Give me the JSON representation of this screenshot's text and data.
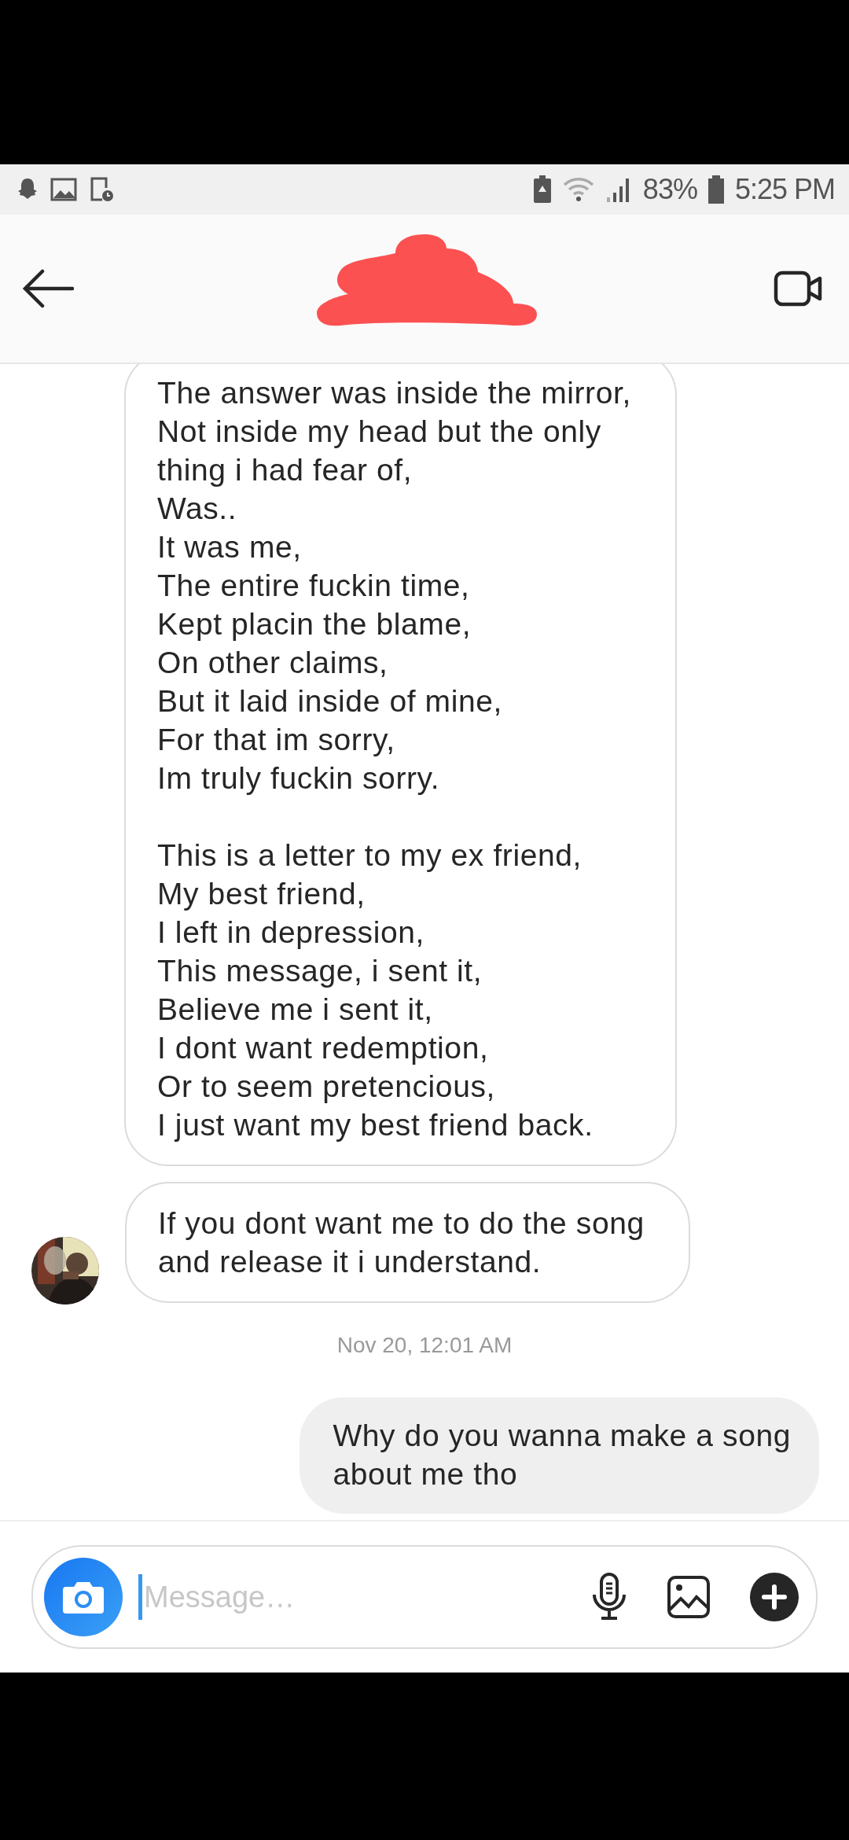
{
  "status_bar": {
    "battery": "83%",
    "time": "5:25 PM"
  },
  "messages": [
    {
      "kind": "received",
      "avatar": false,
      "text": "The answer was inside the mirror,\nNot inside my head but the only\nthing i had fear of,\nWas..\nIt was me,\nThe entire fuckin time,\nKept placin the blame,\nOn other claims,\nBut it laid inside of mine,\nFor that im sorry,\nIm truly fuckin sorry.\n\nThis is a letter to my ex friend,\nMy best friend,\nI left in depression,\nThis message, i sent it,\nBelieve me i sent it,\nI dont want redemption,\nOr to seem pretencious,\nI just want my best friend back."
    },
    {
      "kind": "received",
      "avatar": true,
      "text": "If you dont want me to do the song\nand release it i understand."
    },
    {
      "kind": "timestamp",
      "text": "Nov 20, 12:01 AM"
    },
    {
      "kind": "sent",
      "text": "Why do you wanna make a song\nabout me tho"
    }
  ],
  "composer": {
    "placeholder": "Message…"
  }
}
